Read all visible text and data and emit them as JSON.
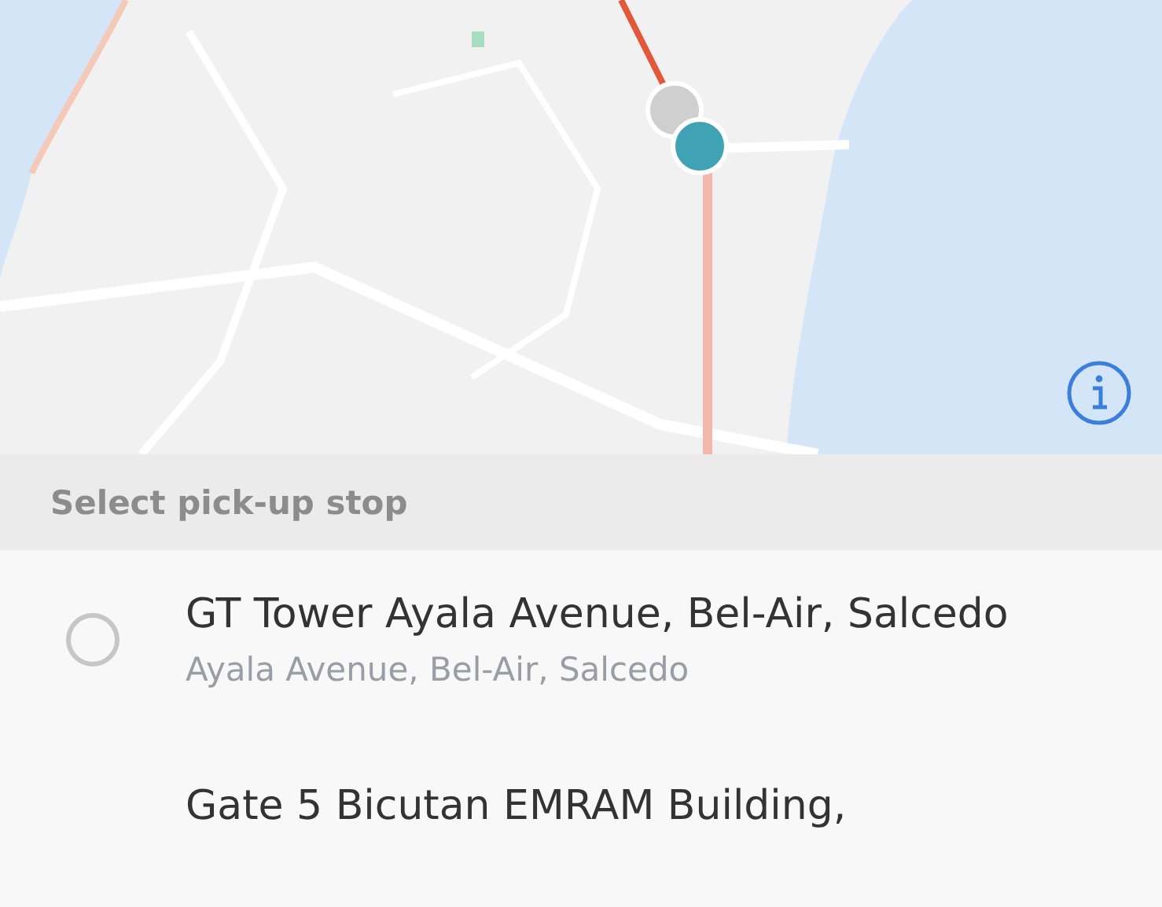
{
  "section": {
    "title": "Select pick-up stop"
  },
  "stops": [
    {
      "name": "GT Tower Ayala Avenue, Bel-Air, Salcedo",
      "address": "Ayala Avenue, Bel-Air, Salcedo",
      "selected": false
    },
    {
      "name": "Gate 5 Bicutan EMRAM Building,"
    }
  ]
}
